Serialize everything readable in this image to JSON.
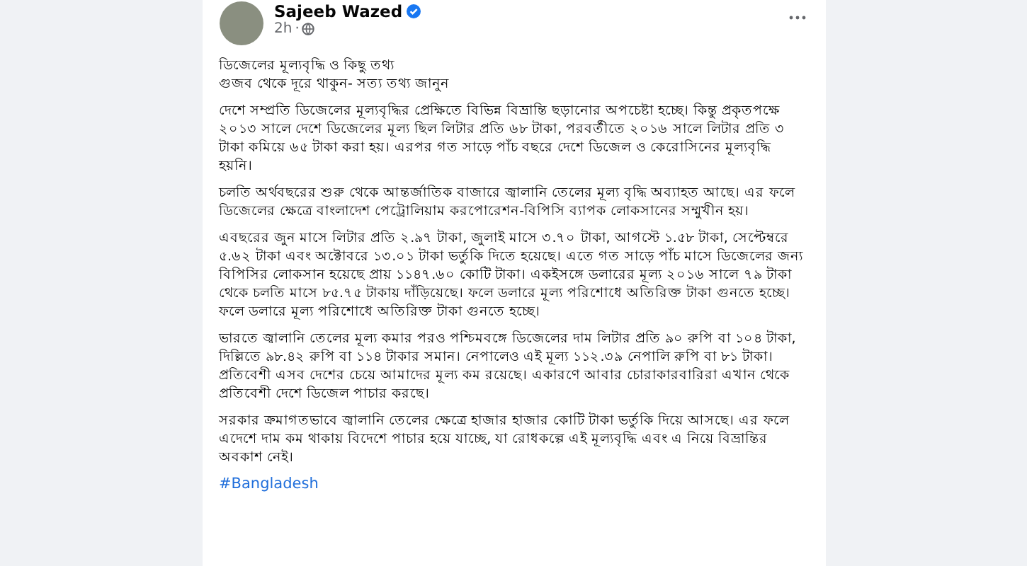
{
  "post": {
    "author": "Sajeeb Wazed",
    "verified": true,
    "time": "2h",
    "separator": "·",
    "title_lines": [
      "ডিজেলের মূল্যবৃদ্ধি ও কিছু তথ্য",
      "গুজব থেকে দূরে থাকুন-  সত্য তথ্য জানুন"
    ],
    "paragraphs": [
      "দেশে সম্প্রতি ডিজেলের মূল্যবৃদ্ধির প্রেক্ষিতে বিভিন্ন বিভ্রান্তি ছড়ানোর অপচেষ্টা হচ্ছে। কিন্তু প্রকৃতপক্ষে ২০১৩ সালে দেশে ডিজেলের মূল্য ছিল লিটার প্রতি ৬৮ টাকা, পরবর্তীতে ২০১৬ সালে লিটার প্রতি ৩ টাকা কমিয়ে ৬৫ টাকা করা হয়। এরপর গত সাড়ে পাঁচ বছরে দেশে ডিজেল ও কেরোসিনের মূল্যবৃদ্ধি হয়নি।",
      "চলতি অর্থবছরের শুরু থেকে আন্তর্জাতিক বাজারে জ্বালানি তেলের মূল্য বৃদ্ধি অব্যাহত আছে। এর ফলে ডিজেলের ক্ষেত্রে বাংলাদেশ পেট্রোলিয়াম করপোরেশন-বিপিসি ব্যাপক লোকসানের সম্মুখীন হয়।",
      "এবছরের জুন মাসে লিটার প্রতি ২.৯৭ টাকা, জুলাই মাসে ৩.৭০ টাকা, আগস্টে ১.৫৮ টাকা, সেপ্টেম্বরে ৫.৬২ টাকা এবং অক্টোবরে ১৩.০১ টাকা ভর্তুকি দিতে হয়েছে। এতে গত সাড়ে পাঁচ মাসে ডিজেলের জন্য বিপিসির লোকসান হয়েছে প্রায় ১১৪৭.৬০ কোটি টাকা। একইসঙ্গে ডলারের মূল্য ২০১৬ সালে ৭৯ টাকা থেকে চলতি মাসে ৮৫.৭৫ টাকায় দাঁড়িয়েছে। ফলে ডলারে মূল্য পরিশোধে অতিরিক্ত টাকা গুনতে হচ্ছে। ফলে ডলারে মূল্য পরিশোধে অতিরিক্ত টাকা গুনতে হচ্ছে।",
      "ভারতে জ্বালানি তেলের মূল্য কমার পরও পশ্চিমবঙ্গে ডিজেলের দাম লিটার প্রতি ৯০ রুপি বা ১০৪ টাকা, দিল্লিতে ৯৮.৪২ রুপি বা ১১৪ টাকার সমান। নেপালেও এই মূল্য ১১২.৩৯ নেপালি রুপি বা ৮১ টাকা। প্রতিবেশী এসব দেশের চেয়ে আমাদের মূল্য কম রয়েছে। একারণে আবার চোরাকারবারিরা এখান থেকে প্রতিবেশী দেশে ডিজেল পাচার করছে।",
      "সরকার ক্রমাগতভাবে জ্বালানি তেলের ক্ষেত্রে হাজার হাজার কোটি টাকা ভর্তুকি দিয়ে আসছে। এর ফলে এদেশে দাম কম থাকায় বিদেশে পাচার হয়ে যাচ্ছে, যা রোধকল্পে এই মূল্যবৃদ্ধি এবং এ নিয়ে বিভ্রান্তির অবকাশ নেই।"
    ],
    "hashtag": "#Bangladesh"
  }
}
